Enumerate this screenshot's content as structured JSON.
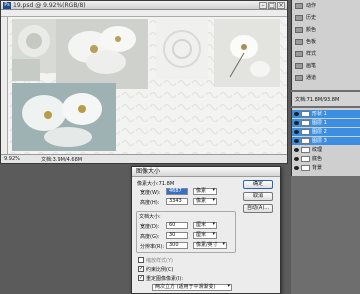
{
  "document": {
    "title": "19.psd @ 9.92%(RGB/8)",
    "zoom": "9.92%",
    "status": "文档:3.9M/4.68M"
  },
  "panels": {
    "history_items": [
      "动作",
      "历史",
      "颜色",
      "色板",
      "样式",
      "画笔",
      "通道"
    ],
    "info_text": "文档:71.8M/93.8M",
    "layers": [
      {
        "name": "形状 1",
        "selected": true
      },
      {
        "name": "图层 1",
        "selected": true
      },
      {
        "name": "图层 2",
        "selected": true
      },
      {
        "name": "图层 3",
        "selected": true
      },
      {
        "name": "纹理",
        "selected": false
      },
      {
        "name": "底色",
        "selected": false
      },
      {
        "name": "背景",
        "selected": false
      }
    ]
  },
  "dialog": {
    "title": "图像大小",
    "pixel_size_label": "像素大小:71.8M",
    "width_label": "宽度(W):",
    "width_value": "4687",
    "width_unit": "像素",
    "height_label": "高度(H):",
    "height_value": "3343",
    "height_unit": "像素",
    "doc_size_label": "文档大小:",
    "doc_width_label": "宽度(D):",
    "doc_width_value": "60",
    "doc_width_unit": "厘米",
    "doc_height_label": "高度(G):",
    "doc_height_value": "30",
    "doc_height_unit": "厘米",
    "resolution_label": "分辨率(R):",
    "resolution_value": "300",
    "resolution_unit": "像素/英寸",
    "scale_styles": "缩放样式(Y)",
    "constrain": "约束比例(C)",
    "resample": "重定图像像素(I):",
    "resample_method": "两次立方 (适用于平滑渐变)",
    "ok": "确定",
    "cancel": "取消",
    "auto": "自动(A)..."
  }
}
